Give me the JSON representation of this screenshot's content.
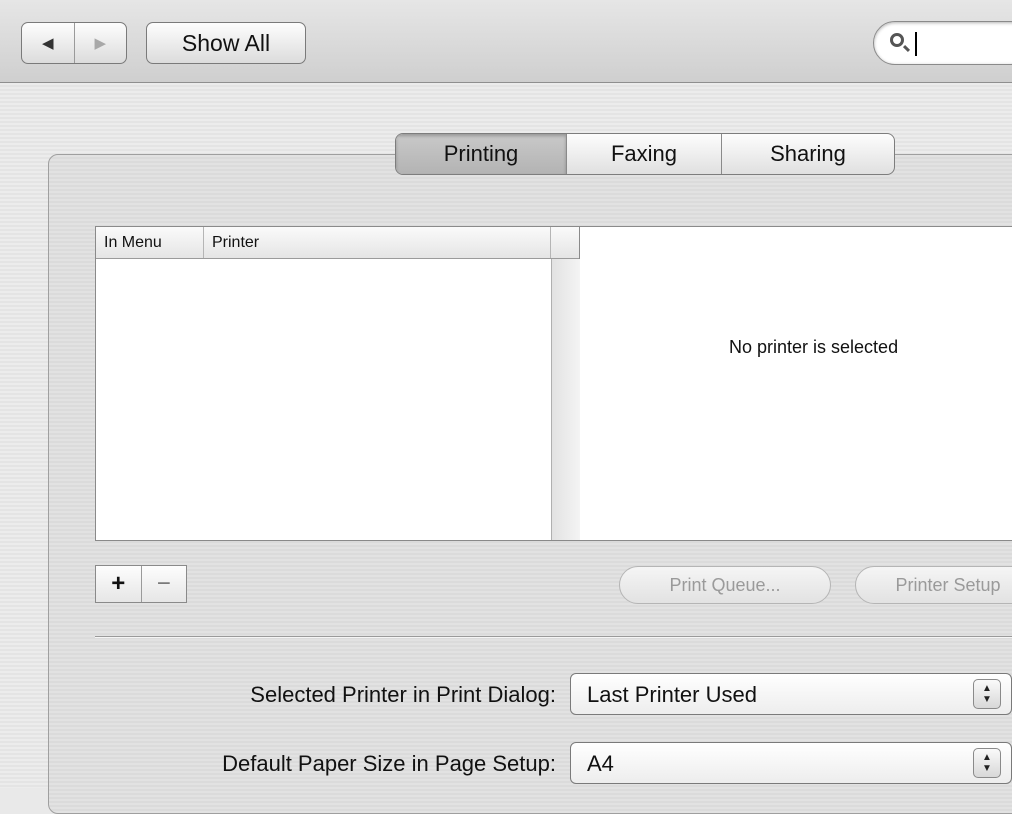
{
  "toolbar": {
    "back_glyph": "◀",
    "forward_glyph": "▶",
    "show_all_label": "Show All",
    "search_value": ""
  },
  "tabs": [
    {
      "label": "Printing",
      "selected": true
    },
    {
      "label": "Faxing",
      "selected": false
    },
    {
      "label": "Sharing",
      "selected": false
    }
  ],
  "printer_table": {
    "columns": [
      "In Menu",
      "Printer"
    ],
    "rows": []
  },
  "detail": {
    "empty_message": "No printer is selected"
  },
  "list_controls": {
    "add_label": "+",
    "remove_label": "−"
  },
  "buttons": {
    "print_queue": "Print Queue...",
    "printer_setup": "Printer Setup"
  },
  "settings": {
    "selected_printer_label": "Selected Printer in Print Dialog:",
    "selected_printer_value": "Last Printer Used",
    "paper_size_label": "Default Paper Size in Page Setup:",
    "paper_size_value": "A4"
  },
  "colors": {
    "toolbar_bg": "#d6d6d6",
    "selected_tab_bg": "#bdbdbd",
    "disabled_text": "#9a9a9a"
  }
}
